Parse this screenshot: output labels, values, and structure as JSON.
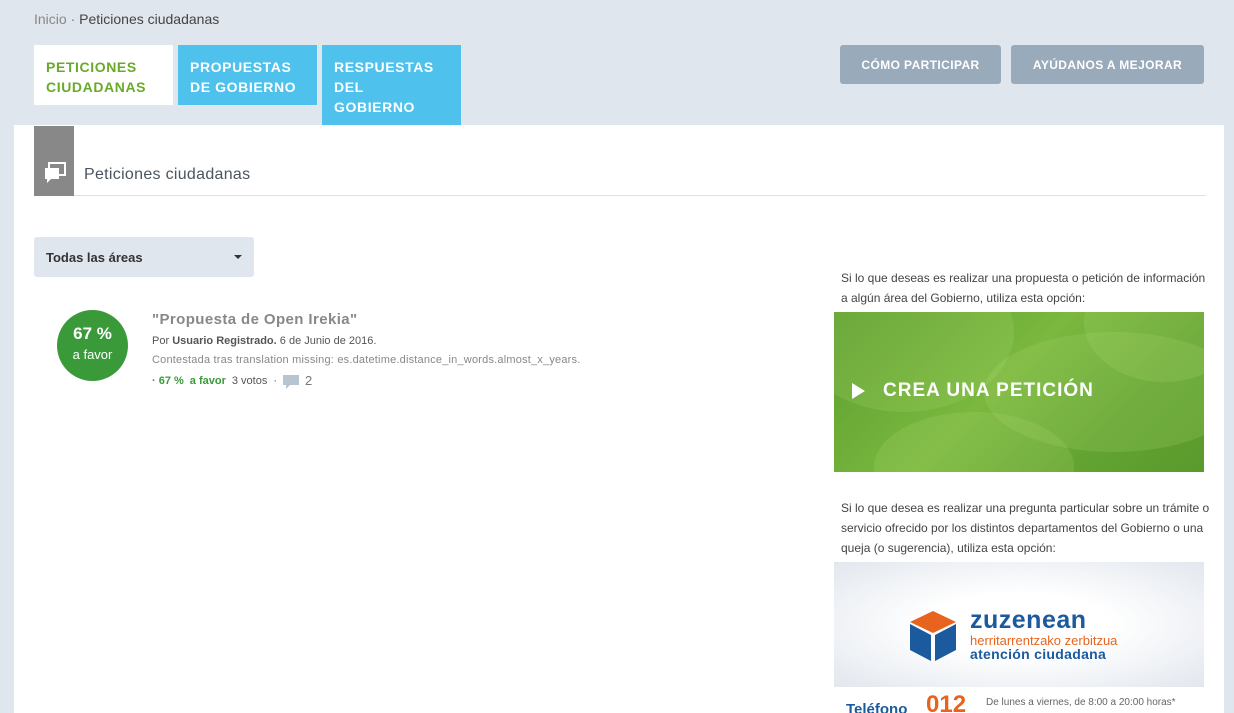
{
  "breadcrumb": {
    "home": "Inicio",
    "separator": "·",
    "current": "Peticiones ciudadanas"
  },
  "tabs": [
    {
      "label": "PETICIONES CIUDADANAS",
      "active": true
    },
    {
      "label": "PROPUESTAS DE GOBIERNO",
      "active": false
    },
    {
      "label": "RESPUESTAS DEL GOBIERNO",
      "active": false
    }
  ],
  "top_buttons": {
    "participar": "CÓMO PARTICIPAR",
    "mejorar": "AYÚDANOS A MEJORAR"
  },
  "section": {
    "title": "Peticiones ciudadanas",
    "icon": "comments-icon"
  },
  "filter": {
    "selected": "Todas las áreas"
  },
  "items": [
    {
      "vote_pct": "67 %",
      "vote_label": "a favor",
      "title": "\"Propuesta de Open Irekia\"",
      "by": "Por",
      "author": "Usuario Registrado.",
      "date": "6 de Junio de 2016.",
      "note": "Contestada tras translation missing: es.datetime.distance_in_words.almost_x_years.",
      "stats_pct": "· 67 %",
      "stats_favor": "a favor",
      "votes": "3 votos",
      "dot": "·",
      "comments": "2"
    }
  ],
  "sidebar": {
    "text1": "Si lo que deseas es realizar una propuesta o petición de información a algún área del Gobierno, utiliza esta opción:",
    "crea_label": "CREA UNA PETICIÓN",
    "text2": "Si lo que desea es realizar una pregunta particular sobre un trámite o servicio ofrecido por los distintos departamentos del Gobierno o una queja (o sugerencia), utiliza esta opción:",
    "zuzenean": {
      "name": "zuzenean",
      "sub1": "herritarrentzako zerbitzua",
      "sub2": "atención ciudadana"
    },
    "phone": {
      "label": "Teléfono",
      "number": "012",
      "hours": "De lunes a viernes, de 8:00 a 20:00 horas*"
    }
  },
  "colors": {
    "page_bg": "#e0e6ee",
    "tab_blue": "#4ec1ec",
    "tab_active_text": "#6aaa2a",
    "button_gray": "#99aabb",
    "vote_green": "#3a9a3a",
    "brand_blue": "#1b5a9c",
    "brand_orange": "#e8641e"
  }
}
